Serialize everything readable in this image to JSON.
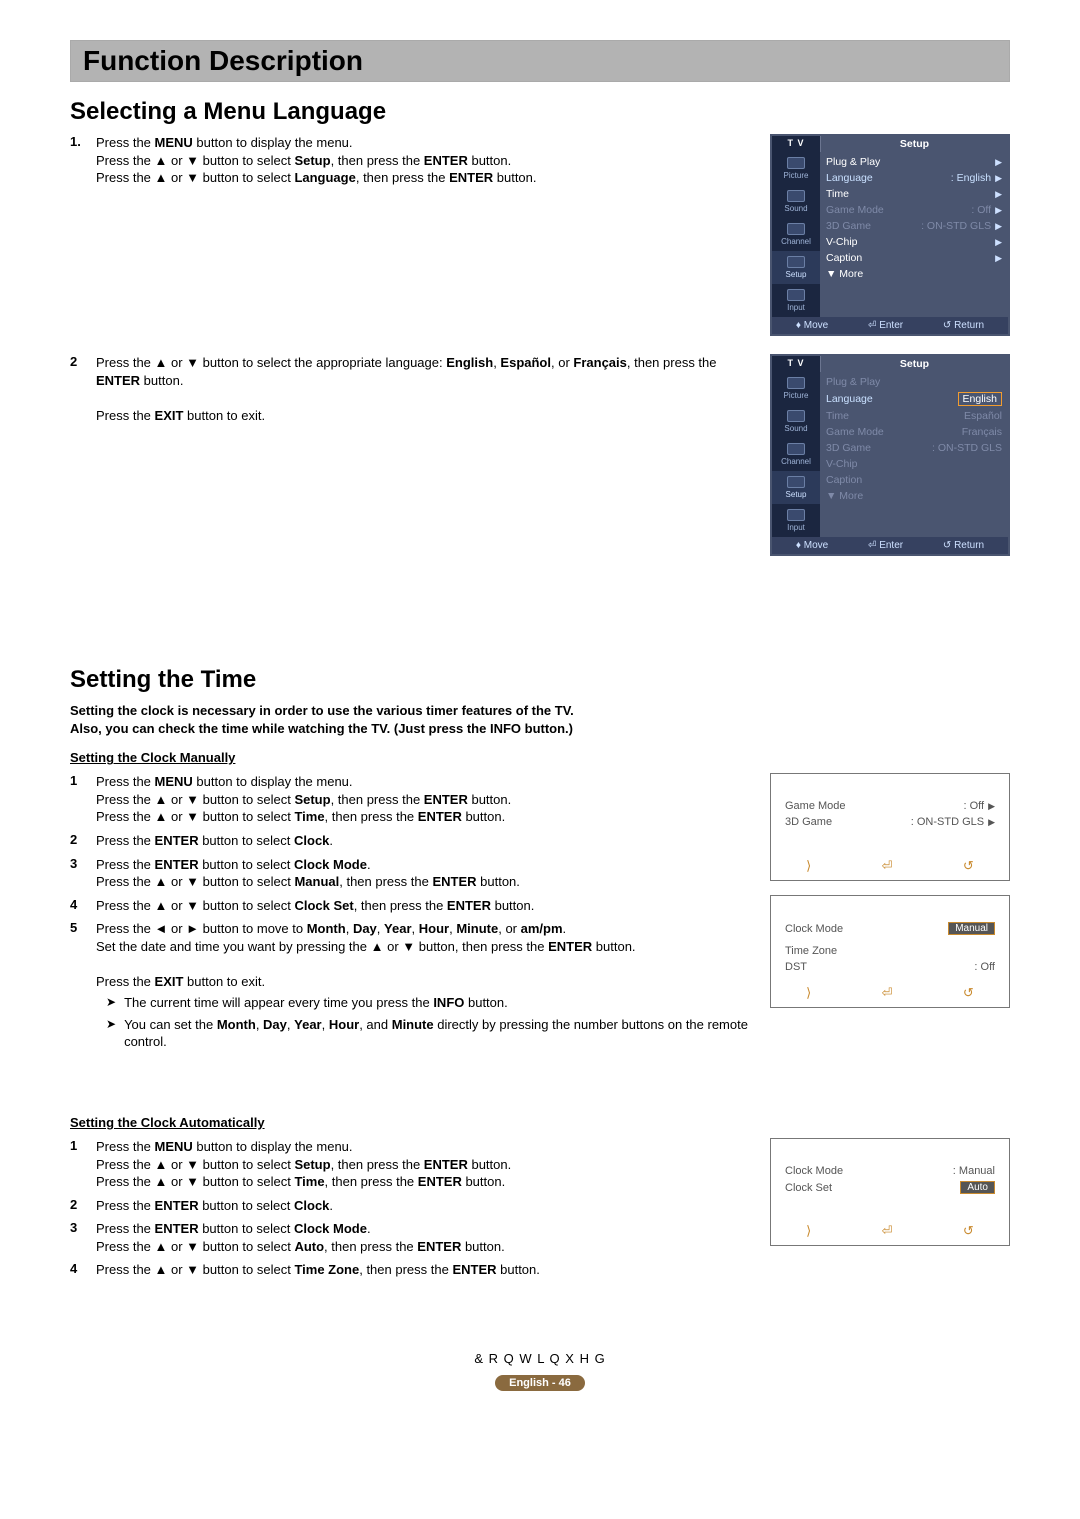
{
  "header": {
    "title": "Function Description"
  },
  "sec1": {
    "title": "Selecting a Menu Language",
    "step1": {
      "num": "1.",
      "l1a": "Press the ",
      "l1b": "MENU",
      "l1c": " button to display the menu.",
      "l2a": "Press the ▲ or ▼ button to select ",
      "l2b": "Setup",
      "l2c": ", then press the ",
      "l2d": "ENTER",
      "l2e": " button.",
      "l3a": "Press the ▲ or ▼ button to select ",
      "l3b": "Language",
      "l3c": ", then press the ",
      "l3d": "ENTER",
      "l3e": " button."
    },
    "step2": {
      "num": "2",
      "l1a": "Press the ▲ or ▼ button to select the appropriate language: ",
      "l1b": "English",
      "l1c": ", ",
      "l1d": "Español",
      "l1e": ", or ",
      "l1f": "Français",
      "l1g": ", then press the ",
      "l1h": "ENTER",
      "l1i": " button.",
      "l2a": "Press the ",
      "l2b": "EXIT",
      "l2c": " button to exit."
    }
  },
  "osd": {
    "tv": "T V",
    "setup": "Setup",
    "side": [
      "Picture",
      "Sound",
      "Channel",
      "Setup",
      "Input"
    ],
    "items": {
      "plug": "Plug & Play",
      "lang": "Language",
      "lang_val": ": English",
      "time": "Time",
      "game": "Game Mode",
      "game_val": ": Off",
      "g3d": "3D Game",
      "g3d_val": ": ON-STD GLS",
      "vchip": "V-Chip",
      "caption": "Caption",
      "more": "▼ More"
    },
    "opts": {
      "en": "English",
      "es": "Español",
      "fr": "Français"
    },
    "foot": {
      "move": "Move",
      "enter": "Enter",
      "return": "Return"
    }
  },
  "sec2": {
    "title": "Setting the Time",
    "intro1": "Setting the clock is necessary in order to use the various timer features of the TV.",
    "intro2": "Also, you can check the time while watching the TV. (Just press the INFO button.)",
    "manual": {
      "head": "Setting the Clock Manually",
      "s1": {
        "num": "1",
        "l1a": "Press the ",
        "l1b": "MENU",
        "l1c": " button to display the menu.",
        "l2a": "Press the ▲ or ▼ button to select ",
        "l2b": "Setup",
        "l2c": ", then press the ",
        "l2d": "ENTER",
        "l2e": " button.",
        "l3a": "Press the ▲ or ▼ button to select ",
        "l3b": "Time",
        "l3c": ", then press the ",
        "l3d": "ENTER",
        "l3e": " button."
      },
      "s2": {
        "num": "2",
        "a": "Press the ",
        "b": "ENTER",
        "c": " button to select ",
        "d": "Clock",
        "e": "."
      },
      "s3": {
        "num": "3",
        "a": "Press the ",
        "b": "ENTER",
        "c": " button to select ",
        "d": "Clock Mode",
        "e": ".",
        "l2a": "Press the ▲ or ▼ button to select ",
        "l2b": "Manual",
        "l2c": ", then press the ",
        "l2d": "ENTER",
        "l2e": " button."
      },
      "s4": {
        "num": "4",
        "a": "Press the ▲ or ▼ button to select ",
        "b": "Clock Set",
        "c": ", then press the ",
        "d": "ENTER",
        "e": " button."
      },
      "s5": {
        "num": "5",
        "a": "Press the ◄ or ► button to  move to ",
        "b": "Month",
        "c": ", ",
        "d": "Day",
        "e": ", ",
        "f": "Year",
        "g": ", ",
        "h": "Hour",
        "i": ", ",
        "j": "Minute",
        "k": ", or ",
        "l": "am/pm",
        "m": ".",
        "l2": "Set the date and time you want by pressing the ▲ or ▼ button, then press the ",
        "l2b": "ENTER",
        "l2c": " button.",
        "l3a": "Press the ",
        "l3b": "EXIT",
        "l3c": " button to exit.",
        "n1a": "The current time will appear every time you press the ",
        "n1b": "INFO",
        "n1c": " button.",
        "n2a": "You can set the ",
        "n2b": "Month",
        "n2c": ", ",
        "n2d": "Day",
        "n2e": ", ",
        "n2f": "Year",
        "n2g": ", ",
        "n2h": "Hour",
        "n2i": ", and ",
        "n2j": "Minute",
        "n2k": " directly by pressing the number buttons on the remote control."
      }
    },
    "auto": {
      "head": "Setting the Clock Automatically",
      "s1": {
        "num": "1",
        "l1a": "Press the ",
        "l1b": "MENU",
        "l1c": " button to display the menu.",
        "l2a": "Press the ▲ or ▼ button to select ",
        "l2b": "Setup",
        "l2c": ", then press the ",
        "l2d": "ENTER",
        "l2e": " button.",
        "l3a": "Press the ▲ or ▼ button to select ",
        "l3b": "Time",
        "l3c": ", then press the ",
        "l3d": "ENTER",
        "l3e": " button."
      },
      "s2": {
        "num": "2",
        "a": "Press the ",
        "b": "ENTER",
        "c": " button to select ",
        "d": "Clock",
        "e": "."
      },
      "s3": {
        "num": "3",
        "a": "Press the ",
        "b": "ENTER",
        "c": " button to select ",
        "d": "Clock Mode",
        "e": ".",
        "l2a": "Press the ▲ or ▼ button to select ",
        "l2b": "Auto",
        "l2c": ", then press the ",
        "l2d": "ENTER",
        "l2e": " button."
      },
      "s4": {
        "num": "4",
        "a": "Press the ▲ or ▼ button to select ",
        "b": "Time Zone",
        "c": ", then press the ",
        "d": "ENTER",
        "e": " button."
      }
    }
  },
  "mini": {
    "game": "Game Mode",
    "game_v": ": Off",
    "g3d": "3D Game",
    "g3d_v": ": ON-STD GLS",
    "cmode": "Clock Mode",
    "manual": "Manual",
    "tz": "Time Zone",
    "dst": "DST",
    "dst_v": ": Off",
    "cmode2": "Clock Mode",
    "cmode2_v": ": Manual",
    "cset": "Clock Set",
    "auto": "Auto"
  },
  "footer": {
    "crop": "& R Q W L Q X H G",
    "page": "English - 46"
  }
}
